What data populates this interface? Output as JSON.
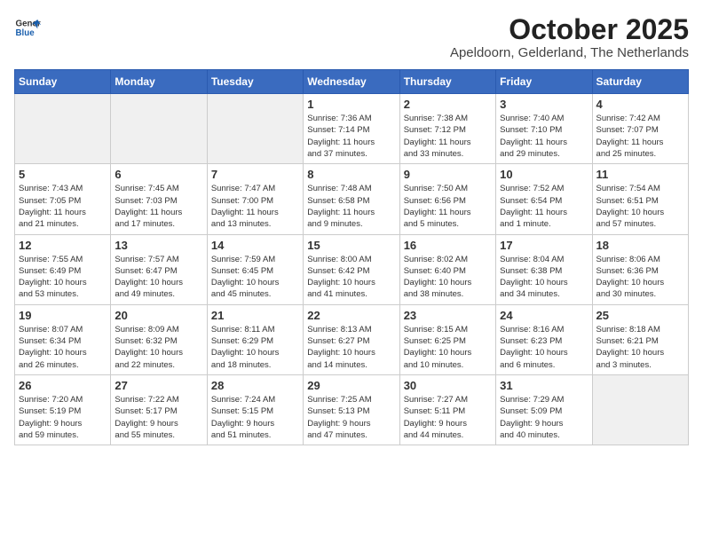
{
  "logo": {
    "general": "General",
    "blue": "Blue"
  },
  "title": "October 2025",
  "subtitle": "Apeldoorn, Gelderland, The Netherlands",
  "headers": [
    "Sunday",
    "Monday",
    "Tuesday",
    "Wednesday",
    "Thursday",
    "Friday",
    "Saturday"
  ],
  "weeks": [
    [
      {
        "day": "",
        "info": ""
      },
      {
        "day": "",
        "info": ""
      },
      {
        "day": "",
        "info": ""
      },
      {
        "day": "1",
        "info": "Sunrise: 7:36 AM\nSunset: 7:14 PM\nDaylight: 11 hours\nand 37 minutes."
      },
      {
        "day": "2",
        "info": "Sunrise: 7:38 AM\nSunset: 7:12 PM\nDaylight: 11 hours\nand 33 minutes."
      },
      {
        "day": "3",
        "info": "Sunrise: 7:40 AM\nSunset: 7:10 PM\nDaylight: 11 hours\nand 29 minutes."
      },
      {
        "day": "4",
        "info": "Sunrise: 7:42 AM\nSunset: 7:07 PM\nDaylight: 11 hours\nand 25 minutes."
      }
    ],
    [
      {
        "day": "5",
        "info": "Sunrise: 7:43 AM\nSunset: 7:05 PM\nDaylight: 11 hours\nand 21 minutes."
      },
      {
        "day": "6",
        "info": "Sunrise: 7:45 AM\nSunset: 7:03 PM\nDaylight: 11 hours\nand 17 minutes."
      },
      {
        "day": "7",
        "info": "Sunrise: 7:47 AM\nSunset: 7:00 PM\nDaylight: 11 hours\nand 13 minutes."
      },
      {
        "day": "8",
        "info": "Sunrise: 7:48 AM\nSunset: 6:58 PM\nDaylight: 11 hours\nand 9 minutes."
      },
      {
        "day": "9",
        "info": "Sunrise: 7:50 AM\nSunset: 6:56 PM\nDaylight: 11 hours\nand 5 minutes."
      },
      {
        "day": "10",
        "info": "Sunrise: 7:52 AM\nSunset: 6:54 PM\nDaylight: 11 hours\nand 1 minute."
      },
      {
        "day": "11",
        "info": "Sunrise: 7:54 AM\nSunset: 6:51 PM\nDaylight: 10 hours\nand 57 minutes."
      }
    ],
    [
      {
        "day": "12",
        "info": "Sunrise: 7:55 AM\nSunset: 6:49 PM\nDaylight: 10 hours\nand 53 minutes."
      },
      {
        "day": "13",
        "info": "Sunrise: 7:57 AM\nSunset: 6:47 PM\nDaylight: 10 hours\nand 49 minutes."
      },
      {
        "day": "14",
        "info": "Sunrise: 7:59 AM\nSunset: 6:45 PM\nDaylight: 10 hours\nand 45 minutes."
      },
      {
        "day": "15",
        "info": "Sunrise: 8:00 AM\nSunset: 6:42 PM\nDaylight: 10 hours\nand 41 minutes."
      },
      {
        "day": "16",
        "info": "Sunrise: 8:02 AM\nSunset: 6:40 PM\nDaylight: 10 hours\nand 38 minutes."
      },
      {
        "day": "17",
        "info": "Sunrise: 8:04 AM\nSunset: 6:38 PM\nDaylight: 10 hours\nand 34 minutes."
      },
      {
        "day": "18",
        "info": "Sunrise: 8:06 AM\nSunset: 6:36 PM\nDaylight: 10 hours\nand 30 minutes."
      }
    ],
    [
      {
        "day": "19",
        "info": "Sunrise: 8:07 AM\nSunset: 6:34 PM\nDaylight: 10 hours\nand 26 minutes."
      },
      {
        "day": "20",
        "info": "Sunrise: 8:09 AM\nSunset: 6:32 PM\nDaylight: 10 hours\nand 22 minutes."
      },
      {
        "day": "21",
        "info": "Sunrise: 8:11 AM\nSunset: 6:29 PM\nDaylight: 10 hours\nand 18 minutes."
      },
      {
        "day": "22",
        "info": "Sunrise: 8:13 AM\nSunset: 6:27 PM\nDaylight: 10 hours\nand 14 minutes."
      },
      {
        "day": "23",
        "info": "Sunrise: 8:15 AM\nSunset: 6:25 PM\nDaylight: 10 hours\nand 10 minutes."
      },
      {
        "day": "24",
        "info": "Sunrise: 8:16 AM\nSunset: 6:23 PM\nDaylight: 10 hours\nand 6 minutes."
      },
      {
        "day": "25",
        "info": "Sunrise: 8:18 AM\nSunset: 6:21 PM\nDaylight: 10 hours\nand 3 minutes."
      }
    ],
    [
      {
        "day": "26",
        "info": "Sunrise: 7:20 AM\nSunset: 5:19 PM\nDaylight: 9 hours\nand 59 minutes."
      },
      {
        "day": "27",
        "info": "Sunrise: 7:22 AM\nSunset: 5:17 PM\nDaylight: 9 hours\nand 55 minutes."
      },
      {
        "day": "28",
        "info": "Sunrise: 7:24 AM\nSunset: 5:15 PM\nDaylight: 9 hours\nand 51 minutes."
      },
      {
        "day": "29",
        "info": "Sunrise: 7:25 AM\nSunset: 5:13 PM\nDaylight: 9 hours\nand 47 minutes."
      },
      {
        "day": "30",
        "info": "Sunrise: 7:27 AM\nSunset: 5:11 PM\nDaylight: 9 hours\nand 44 minutes."
      },
      {
        "day": "31",
        "info": "Sunrise: 7:29 AM\nSunset: 5:09 PM\nDaylight: 9 hours\nand 40 minutes."
      },
      {
        "day": "",
        "info": ""
      }
    ]
  ]
}
